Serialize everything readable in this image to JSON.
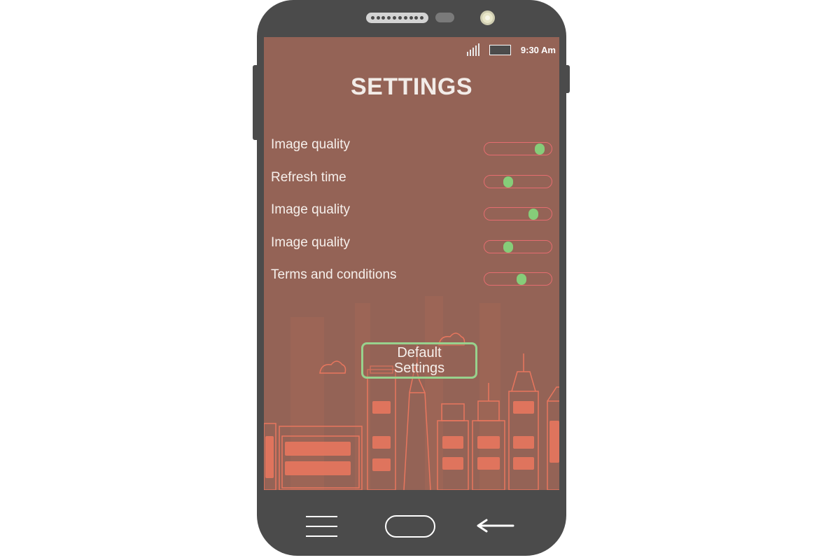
{
  "status_bar": {
    "time": "9:30 Am",
    "signal_icon": "signal-bars-icon",
    "battery_icon": "battery-icon"
  },
  "title": "SETTINGS",
  "settings": [
    {
      "label": "Image quality",
      "value": 0.82
    },
    {
      "label": "Refresh time",
      "value": 0.35
    },
    {
      "label": "Image quality",
      "value": 0.73
    },
    {
      "label": "Image quality",
      "value": 0.35
    },
    {
      "label": "Terms and conditions",
      "value": 0.55
    }
  ],
  "default_button": {
    "label": "Default Settings"
  },
  "nav_bar": {
    "menu_icon": "menu-icon",
    "home_icon": "home-button-icon",
    "back_icon": "back-arrow-icon"
  },
  "colors": {
    "phone_body": "#4b4b4b",
    "screen_background": "#946356",
    "slider_border": "#e56d70",
    "slider_thumb": "#86cd79",
    "button_border": "#98d28d",
    "city_lines": "#e8765e"
  }
}
